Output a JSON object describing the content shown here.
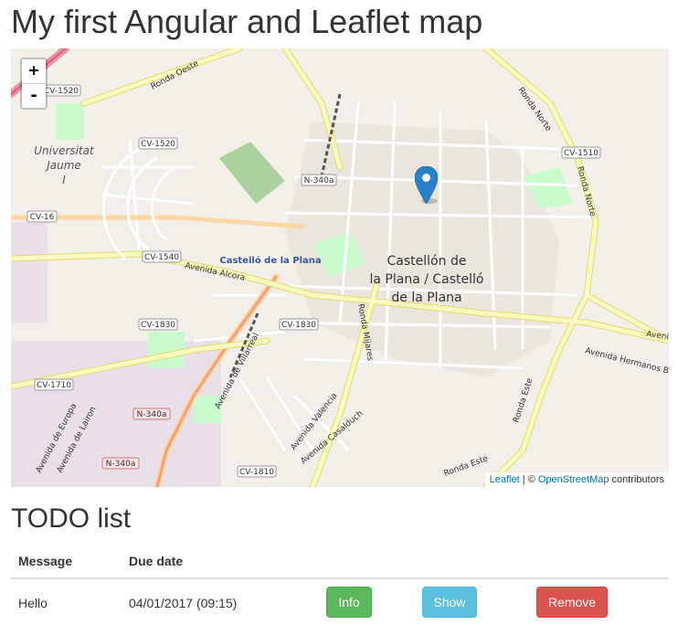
{
  "page": {
    "title": "My first Angular and Leaflet map"
  },
  "map": {
    "zoom_in": "+",
    "zoom_out": "-",
    "attribution": {
      "leaflet": "Leaflet",
      "separator": " | © ",
      "osm": "OpenStreetMap",
      "suffix": " contributors"
    },
    "labels": {
      "city_line1": "Castellón de",
      "city_line2": "la Plana / Castelló",
      "city_line3": "de la Plana",
      "city_alt": "Castelló de la Plana",
      "univ1": "Universitat",
      "univ2": "Jaume",
      "univ3": "I",
      "ronda_oeste": "Ronda Oeste",
      "ronda_norte": "Ronda Norte",
      "ronda_norte2": "Ronda Norte",
      "ronda_mijares": "Ronda Mijares",
      "ronda_este": "Ronda Este",
      "ronda_este2": "Ronda Este",
      "avenida_alcora": "Avenida Alcora",
      "avenida_villarreal": "Avenida de Villarreal",
      "avenida_valencia": "Avenida Valencia",
      "avenida_casalduch": "Avenida Casalduch",
      "avenida_hermanos": "Avenida Hermanos Bou",
      "avenida_europa": "Avenida de Europa",
      "avenida_lairon": "Avenida de Lairon",
      "avenida_right": "Avenida"
    },
    "road_shields": {
      "cv1520a": "CV-1520",
      "cv1520b": "CV-1520",
      "cv1510": "CV-1510",
      "n340a": "N-340a",
      "cv16": "CV-16",
      "cv1540": "CV-1540",
      "cv1830a": "CV-1830",
      "cv1830b": "CV-1830",
      "cv1710": "CV-1710",
      "n340b": "N-340a",
      "n340c": "N-340a",
      "cv1810": "CV-1810"
    },
    "colors": {
      "marker": "#2a81cb",
      "major_road": "#f7fabf",
      "motorway": "#e892a2",
      "park": "#c8facc"
    }
  },
  "todo": {
    "title": "TODO list",
    "columns": {
      "message": "Message",
      "due_date": "Due date"
    },
    "rows": [
      {
        "message": "Hello",
        "due_date": "04/01/2017 (09:15)",
        "info_label": "Info",
        "show_label": "Show",
        "remove_label": "Remove"
      }
    ]
  }
}
